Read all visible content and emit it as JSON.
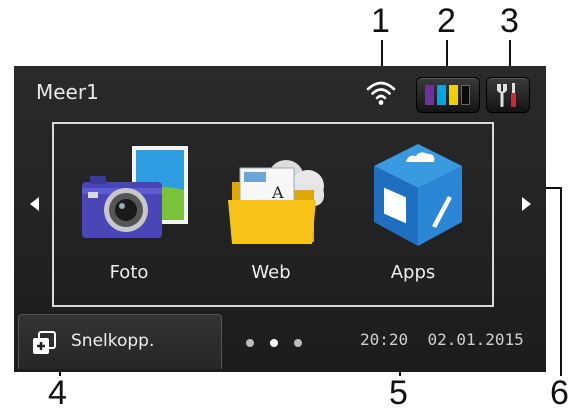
{
  "screen": {
    "title": "Meer1",
    "apps": [
      {
        "label": "Foto",
        "icon": "camera-photo-icon"
      },
      {
        "label": "Web",
        "icon": "web-folder-cloud-icon"
      },
      {
        "label": "Apps",
        "icon": "apps-cube-icon"
      }
    ],
    "shortcut_label": "Snelkopp.",
    "time": "20:20",
    "date": "02.01.2015",
    "page_indicator": {
      "pages": 3,
      "active": 1
    },
    "ink_colors": [
      "#7030a0",
      "#00a6e0",
      "#f0d000",
      "#111111"
    ],
    "colors": {
      "background": "#222222",
      "accent_red": "#d0282c"
    }
  },
  "callouts": [
    "1",
    "2",
    "3",
    "4",
    "5",
    "6"
  ]
}
